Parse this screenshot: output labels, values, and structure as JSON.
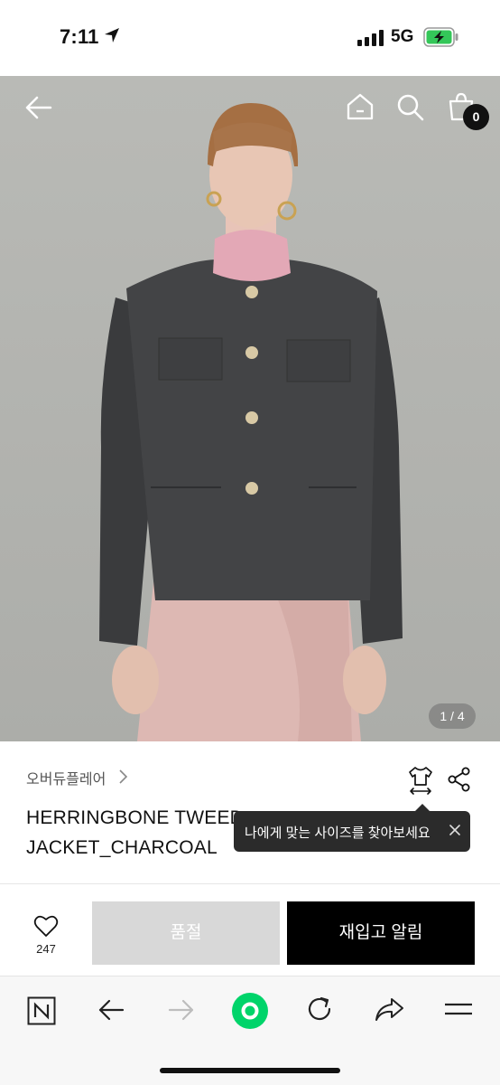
{
  "status_bar": {
    "time": "7:11",
    "network": "5G"
  },
  "header_icons": [
    "back-arrow-icon",
    "home-icon",
    "search-icon",
    "shopping-bag-icon"
  ],
  "cart": {
    "count": "0"
  },
  "gallery": {
    "counter": "1 / 4"
  },
  "product": {
    "brand": "오버듀플레어",
    "title_line1": "HERRINGBONE TWEED",
    "title_line2": "JACKET_CHARCOAL"
  },
  "tooltip": {
    "text": "나에게 맞는 사이즈를 찾아보세요"
  },
  "actions": {
    "like_count": "247",
    "soldout_label": "품절",
    "restock_label": "재입고 알림"
  },
  "colors": {
    "accent_green": "#00d46a",
    "primary_button": "#000000",
    "disabled_button": "#d8d8d8",
    "battery_green": "#34c759"
  },
  "browser_toolbar": [
    "naver-n-icon",
    "back-icon",
    "forward-icon",
    "green-dot-icon",
    "reload-icon",
    "share-icon",
    "menu-icon"
  ]
}
